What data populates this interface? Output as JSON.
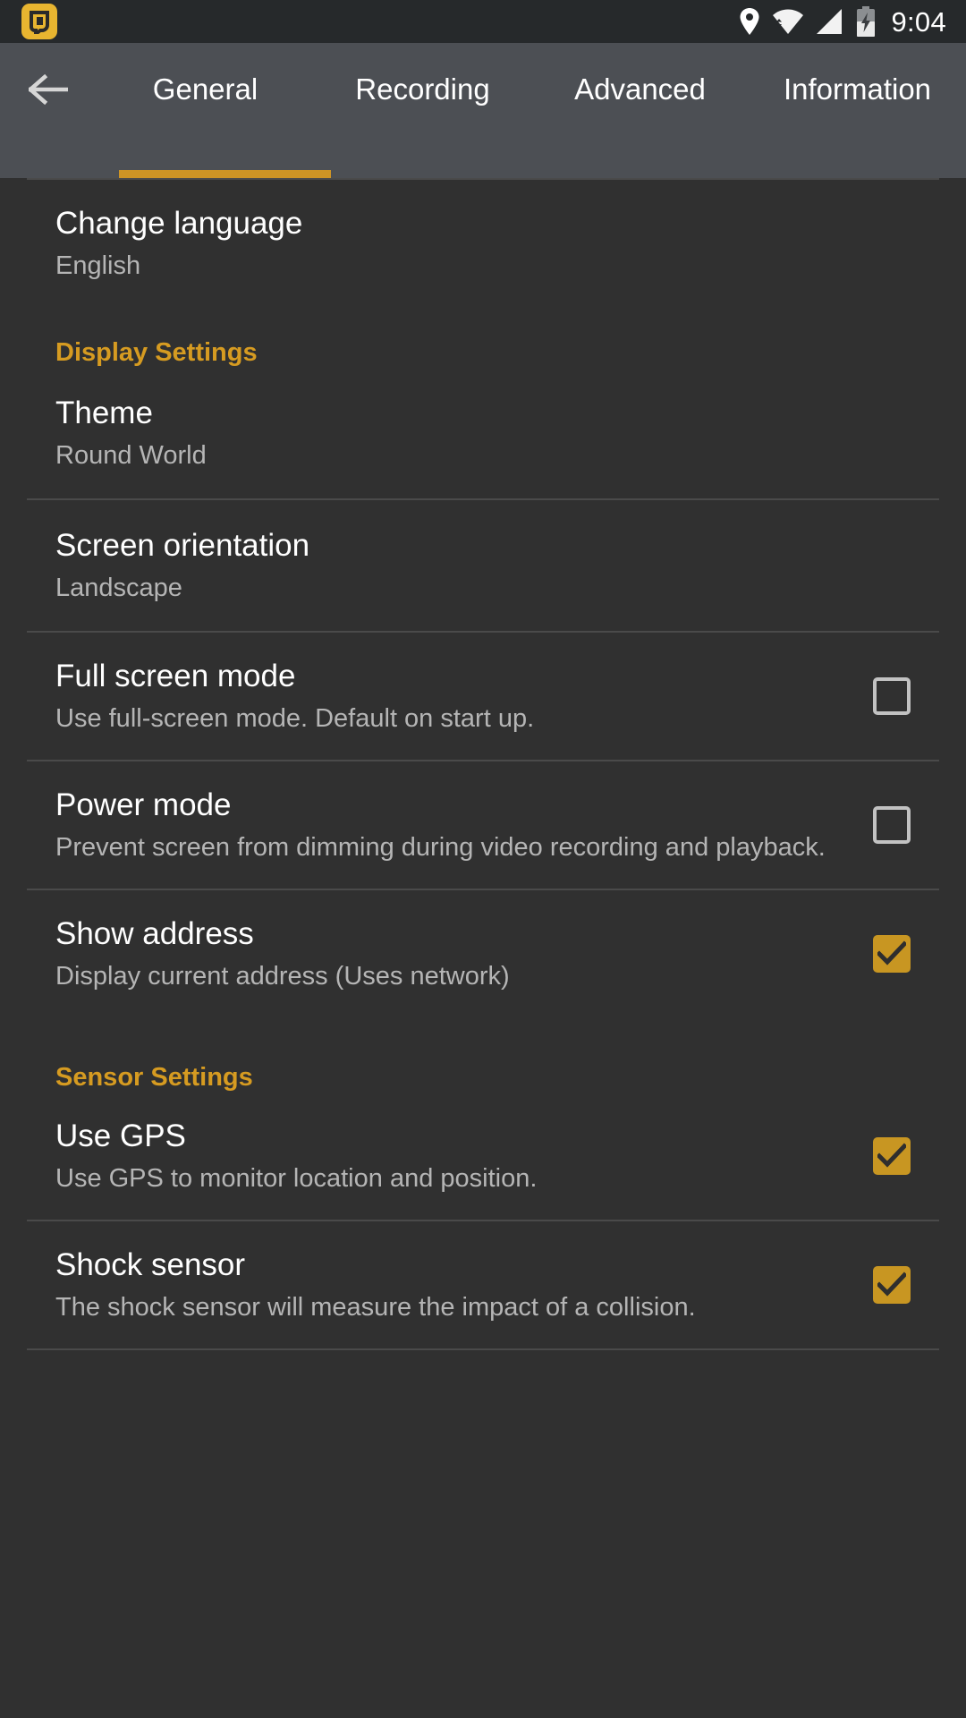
{
  "statusbar": {
    "app_icon": "app-badge-icon",
    "icons": [
      "location-pin-icon",
      "wifi-icon",
      "cellular-signal-icon",
      "battery-charging-icon"
    ],
    "clock": "9:04"
  },
  "appbar": {
    "back_icon": "back-arrow-icon",
    "tabs": [
      {
        "label": "General",
        "active": true
      },
      {
        "label": "Recording",
        "active": false
      },
      {
        "label": "Advanced",
        "active": false
      },
      {
        "label": "Information",
        "active": false
      }
    ],
    "indicator_color": "#cd9425"
  },
  "colors": {
    "accent": "#d69b21",
    "checkbox_on": "#c89622",
    "background": "#303030",
    "appbar": "#4c4f54",
    "statusbar": "#26292b",
    "title": "#ffffff",
    "subtitle": "#b5b5b5",
    "divider": "#4a4a4a"
  },
  "settings": {
    "language": {
      "title": "Change language",
      "value": "English"
    },
    "display_section": "Display Settings",
    "theme": {
      "title": "Theme",
      "value": "Round World"
    },
    "orientation": {
      "title": "Screen orientation",
      "value": "Landscape"
    },
    "fullscreen": {
      "title": "Full screen mode",
      "summary": "Use full-screen mode. Default on start up.",
      "checked": false
    },
    "power_mode": {
      "title": "Power mode",
      "summary": "Prevent screen from dimming during video recording and playback.",
      "checked": false
    },
    "show_address": {
      "title": "Show address",
      "summary": "Display current address (Uses network)",
      "checked": true
    },
    "sensor_section": "Sensor Settings",
    "use_gps": {
      "title": "Use GPS",
      "summary": "Use GPS to monitor location and position.",
      "checked": true
    },
    "shock_sensor": {
      "title": "Shock sensor",
      "summary": "The shock sensor will measure the impact of a collision.",
      "checked": true
    }
  }
}
